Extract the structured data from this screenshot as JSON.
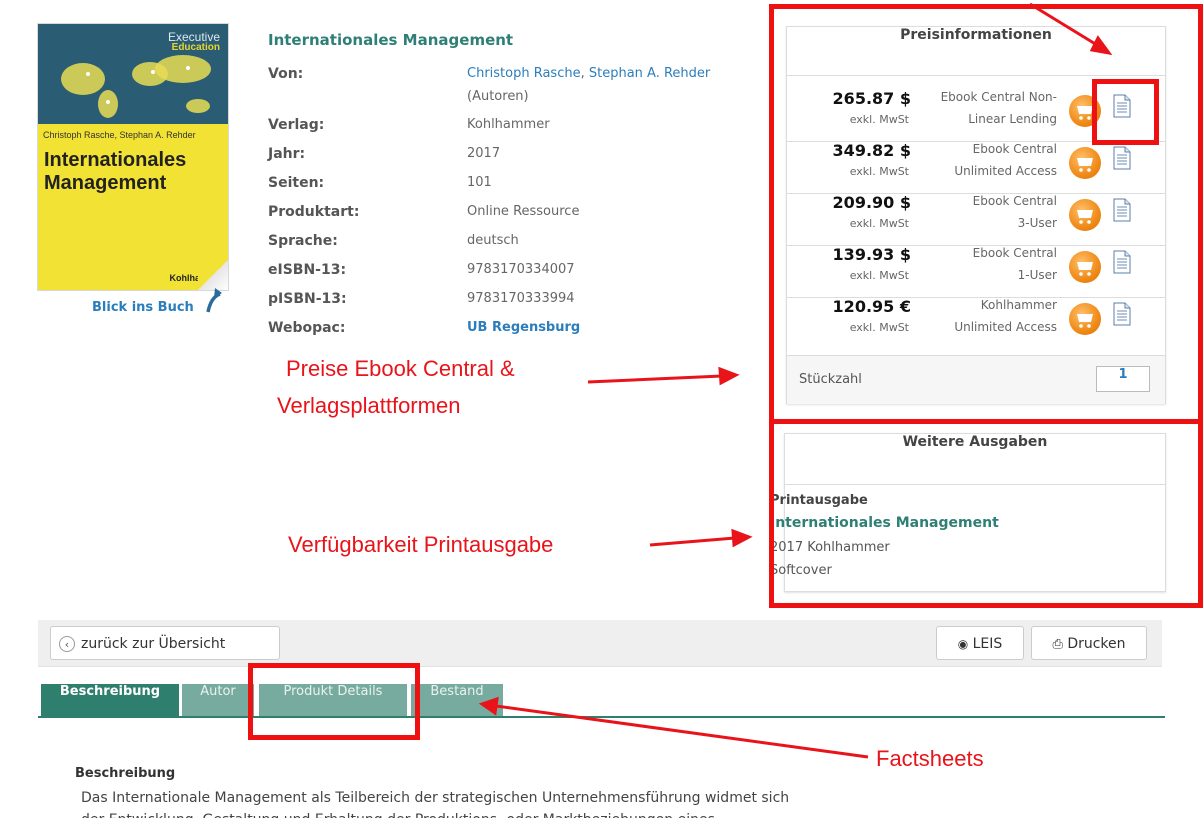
{
  "book": {
    "cover": {
      "series_line1": "Executive",
      "series_line2": "Education",
      "authors": "Christoph Rasche, Stephan A. Rehder",
      "title_line1": "Internationales",
      "title_line2": "Management",
      "publisher": "Kohlham"
    },
    "look_inside": "Blick ins Buch"
  },
  "details": {
    "title": "Internationales Management",
    "rows": [
      {
        "label": "Von:",
        "value": "Christoph Rasche, Stephan A. Rehder",
        "value2": "(Autoren)"
      },
      {
        "label": "Verlag:",
        "value": "Kohlhammer"
      },
      {
        "label": "Jahr:",
        "value": "2017"
      },
      {
        "label": "Seiten:",
        "value": "101"
      },
      {
        "label": "Produktart:",
        "value": "Online Ressource"
      },
      {
        "label": "Sprache:",
        "value": "deutsch"
      },
      {
        "label": "eISBN-13:",
        "value": "9783170334007"
      },
      {
        "label": "pISBN-13:",
        "value": "9783170333994"
      },
      {
        "label": "Webopac:",
        "value": "UB Regensburg"
      }
    ],
    "author_1": "Christoph Rasche",
    "author_sep": ",",
    "author_2": "Stephan A. Rehder"
  },
  "prices": {
    "heading": "Preisinformationen",
    "items": [
      {
        "price": "265.87 $",
        "note": "exkl. MwSt",
        "desc1": "Ebook Central Non-",
        "desc2": "Linear Lending"
      },
      {
        "price": "349.82 $",
        "note": "exkl. MwSt",
        "desc1": "Ebook Central",
        "desc2": "Unlimited Access"
      },
      {
        "price": "209.90 $",
        "note": "exkl. MwSt",
        "desc1": "Ebook Central",
        "desc2": "3-User"
      },
      {
        "price": "139.93 $",
        "note": "exkl. MwSt",
        "desc1": "Ebook Central",
        "desc2": "1-User"
      },
      {
        "price": "120.95 €",
        "note": "exkl. MwSt",
        "desc1": "Kohlhammer",
        "desc2": "Unlimited Access"
      }
    ],
    "quantity_label": "Stückzahl",
    "quantity_value": "1"
  },
  "editions": {
    "heading": "Weitere Ausgaben",
    "type": "Printausgabe",
    "title": "Internationales Management",
    "year_publisher": "2017 Kohlhammer",
    "binding": "Softcover"
  },
  "toolbar": {
    "back_label": "zurück zur Übersicht",
    "leis_label": "LEIS",
    "print_label": "Drucken"
  },
  "tabs": [
    "Beschreibung",
    "Autor",
    "Produkt Details",
    "Bestand"
  ],
  "description": {
    "heading": "Beschreibung",
    "text": "Das Internationale Management als Teilbereich der strategischen Unternehmensführung widmet sich",
    "text2": "der Entwicklung, Gestaltung und Erhaltung der Produktions- oder Marktbeziehungen eines"
  },
  "annotations": {
    "prices_line1": "Preise Ebook Central &",
    "prices_line2": "Verlagsplattformen",
    "print_availability": "Verfügbarkeit Printausgabe",
    "factsheets": "Factsheets"
  },
  "colors": {
    "accent_red": "#ee1111",
    "tab_green": "#2e7f6e",
    "link_blue": "#2b7dbb",
    "cart_orange": "#f08a18"
  }
}
